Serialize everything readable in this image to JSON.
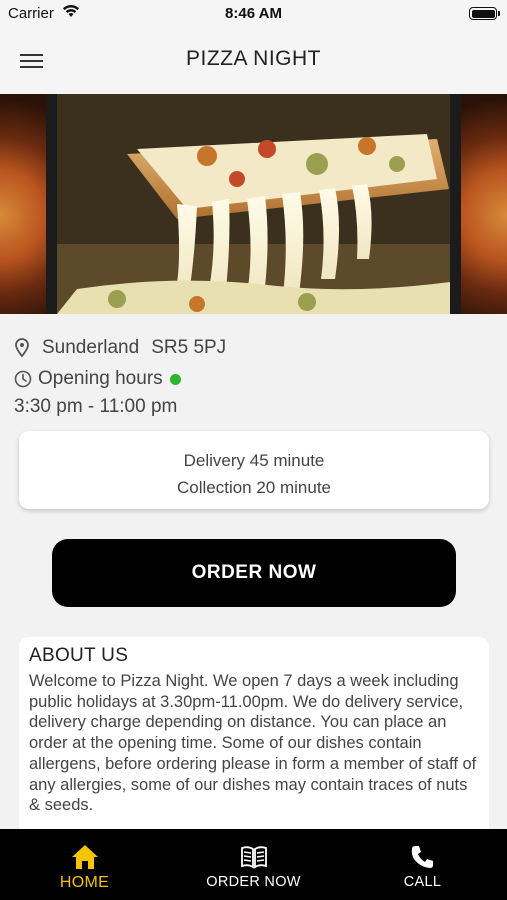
{
  "status_bar": {
    "carrier": "Carrier",
    "time": "8:46 AM"
  },
  "nav": {
    "title": "PIZZA NIGHT"
  },
  "store": {
    "location_city": "Sunderland",
    "location_postcode": "SR5 5PJ",
    "opening_label": "Opening hours",
    "opening_status_color": "#2db52d",
    "opening_time": "3:30 pm - 11:00 pm"
  },
  "times": {
    "delivery": "Delivery 45 minute",
    "collection": "Collection 20 minute"
  },
  "order_button": {
    "label": "ORDER NOW"
  },
  "about": {
    "title": "ABOUT US",
    "text": "Welcome to Pizza Night. We open 7 days a week including public holidays at 3.30pm-11.00pm. We do delivery service, delivery charge depending on distance. You can place an order at the opening time. Some of our dishes contain allergens, before ordering please in form a member of staff of any allergies, some of our dishes may contain traces of nuts & seeds."
  },
  "tabbar": {
    "accent_color": "#f5c400",
    "items": [
      {
        "label": "HOME",
        "icon": "home-icon"
      },
      {
        "label": "ORDER NOW",
        "icon": "menu-book-icon"
      },
      {
        "label": "CALL",
        "icon": "phone-icon"
      }
    ]
  }
}
